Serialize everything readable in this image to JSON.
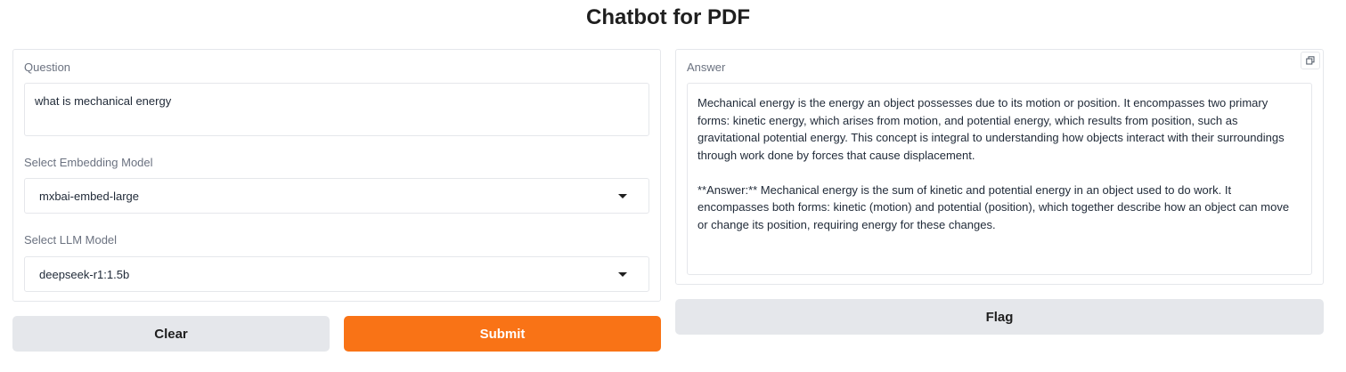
{
  "header": {
    "title": "Chatbot for PDF"
  },
  "question": {
    "label": "Question",
    "value": "what is mechanical energy"
  },
  "embedding": {
    "label": "Select Embedding Model",
    "selected": "mxbai-embed-large"
  },
  "llm": {
    "label": "Select LLM Model",
    "selected": "deepseek-r1:1.5b"
  },
  "answer": {
    "label": "Answer",
    "paragraphs": [
      "Mechanical energy is the energy an object possesses due to its motion or position. It encompasses two primary forms: kinetic energy, which arises from motion, and potential energy, which results from position, such as gravitational potential energy. This concept is integral to understanding how objects interact with their surroundings through work done by forces that cause displacement.",
      "**Answer:** Mechanical energy is the sum of kinetic and potential energy in an object used to do work. It encompasses both forms: kinetic (motion) and potential (position), which together describe how an object can move or change its position, requiring energy for these changes."
    ]
  },
  "buttons": {
    "clear": "Clear",
    "submit": "Submit",
    "flag": "Flag"
  },
  "icons": {
    "copy": "copy-icon",
    "dropdown": "chevron-down-icon"
  },
  "colors": {
    "submit": "#f97316",
    "secondary": "#e5e7eb"
  }
}
